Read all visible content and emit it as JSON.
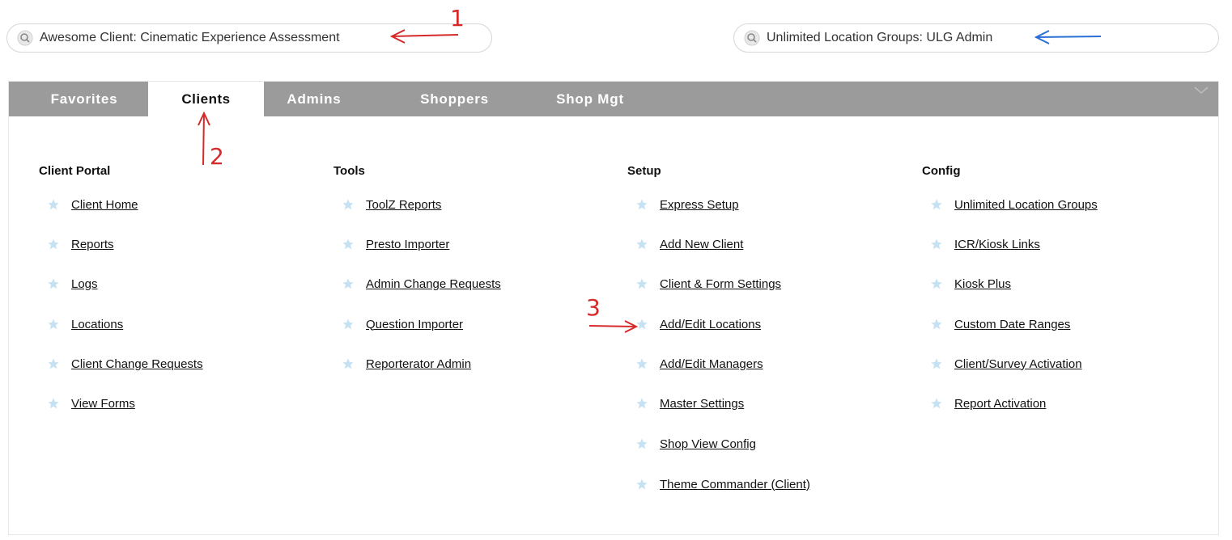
{
  "search_left": {
    "value": "Awesome Client: Cinematic Experience Assessment",
    "icon": "search-icon"
  },
  "search_right": {
    "value": "Unlimited Location Groups: ULG Admin",
    "icon": "search-icon"
  },
  "tabs": [
    {
      "label": "Favorites",
      "active": false
    },
    {
      "label": "Clients",
      "active": true
    },
    {
      "label": "Admins",
      "active": false
    },
    {
      "label": "Shoppers",
      "active": false
    },
    {
      "label": "Shop Mgt",
      "active": false
    }
  ],
  "columns": [
    {
      "heading": "Client Portal",
      "items": [
        "Client Home",
        "Reports",
        "Logs",
        "Locations",
        "Client Change Requests",
        "View Forms"
      ]
    },
    {
      "heading": "Tools",
      "items": [
        "ToolZ Reports",
        "Presto Importer",
        "Admin Change Requests",
        "Question Importer",
        "Reporterator Admin"
      ]
    },
    {
      "heading": "Setup",
      "items": [
        "Express Setup",
        "Add New Client",
        "Client & Form Settings",
        "Add/Edit Locations",
        "Add/Edit Managers",
        "Master Settings",
        "Shop View Config",
        "Theme Commander (Client)"
      ]
    },
    {
      "heading": "Config",
      "items": [
        "Unlimited Location Groups",
        "ICR/Kiosk Links",
        "Kiosk Plus",
        "Custom Date Ranges",
        "Client/Survey Activation",
        "Report Activation"
      ]
    }
  ],
  "annotations": {
    "a1": "1",
    "a2": "2",
    "a3": "3"
  },
  "colors": {
    "tabbar": "#9b9b9b",
    "star": "#c6e2f2",
    "annotation_red": "#d62a2a",
    "annotation_blue": "#2a6fd6"
  }
}
